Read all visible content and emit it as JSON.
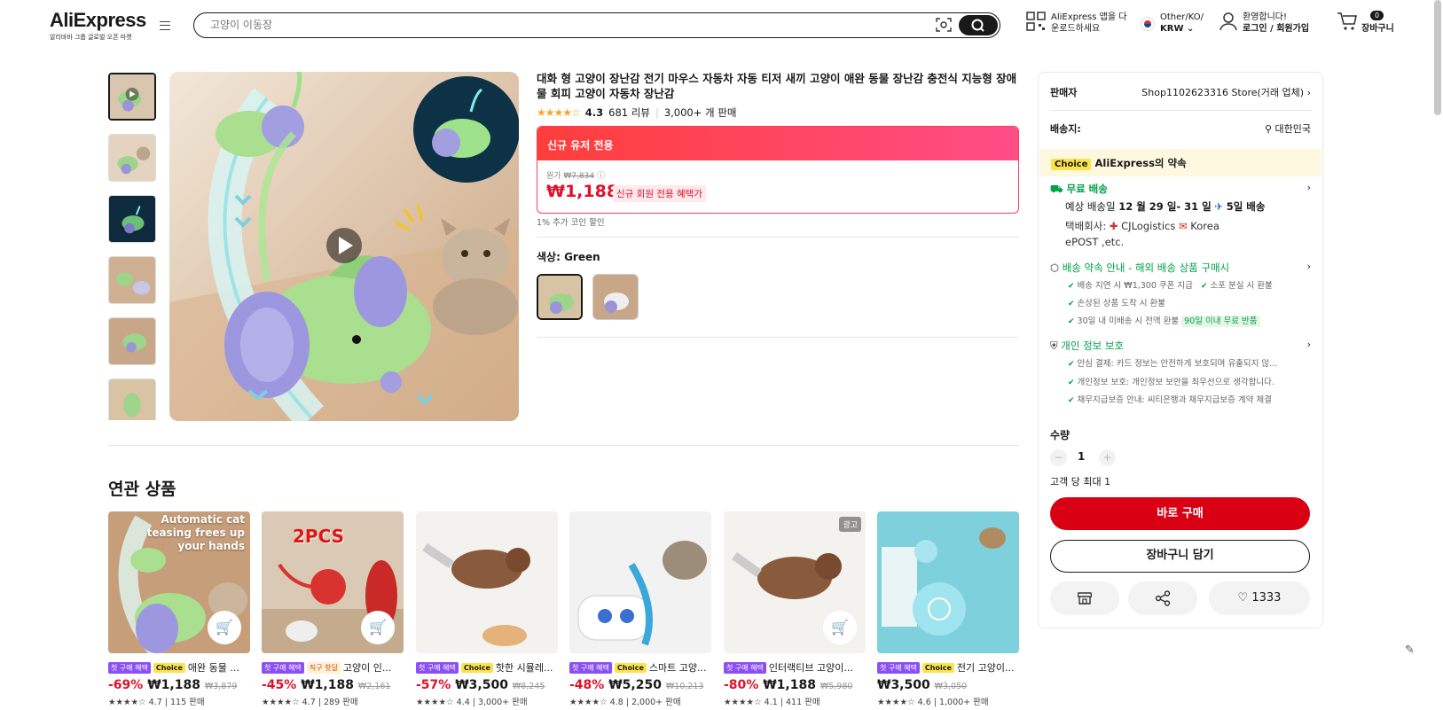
{
  "header": {
    "brand": "AliExpress",
    "brand_sub": "알리바바 그룹 글로벌 오픈 마켓",
    "search_placeholder": "고양이 이동장",
    "app_line1": "AliExpress 앱을 다",
    "app_line2": "운로드하세요",
    "region_line1": "Other/KO/",
    "region_line2": "KRW",
    "account_line1": "환영합니다!",
    "account_line2": "로그인 / 회원가입",
    "cart_count": "0",
    "cart_label": "장바구니"
  },
  "product": {
    "title": "대화 형 고양이 장난감 전기 마우스 자동차 자동 티저 새끼 고양이 애완 동물 장난감 충전식 지능형 장애물 회피 고양이 자동차 장난감",
    "rating": "4.3",
    "reviews": "681 리뷰",
    "sold": "3,000+ 개 판매",
    "promo_header": "신규 유저 전용",
    "orig_label": "원가",
    "orig_price": "₩7,834",
    "price": "₩1,188",
    "new_member_badge": "신규 회원 전용 혜택가",
    "coin_note": "1% 추가 코인 할인",
    "color_label": "색상:",
    "color_value": "Green"
  },
  "seller": {
    "seller_label": "판매자",
    "store": "Shop1102623316 Store(거래 업체)",
    "ship_to_label": "배송지:",
    "ship_to": "대한민국",
    "choice_tag": "Choice",
    "choice_promise": "AliExpress의 약속",
    "free_shipping": "무료 배송",
    "delivery_prefix": "예상 배송일",
    "delivery_dates": "12 월 29 일- 31 일",
    "delivery_days": "5일 배송",
    "carrier_label": "택배회사:",
    "carrier1": "CJLogistics",
    "carrier2": "Korea",
    "carrier_rest": "ePOST ,etc.",
    "guarantee_title": "배송 약속 안내 - 해외 배송 상품 구매시",
    "g1": "배송 지연 시 ₩1,300 쿠폰 지급",
    "g2": "소포 분실 시 환불",
    "g3": "손상된 상품 도착 시 환불",
    "g4": "30일 내 미배송 시 전액 환불",
    "g4_tag": "90일 이내 무료 반품",
    "privacy_title": "개인 정보 보호",
    "p1": "안심 결제: 카드 정보는 안전하게 보호되며 유출되지 않...",
    "p2": "개인정보 보호: 개인정보 보안을 최우선으로 생각합니다.",
    "p3": "채무지급보증 안내: 씨티은행과 채무지급보증 계약 체결",
    "qty_label": "수량",
    "qty_value": "1",
    "qty_limit": "고객 당 최대 1",
    "buy_now": "바로 구매",
    "add_to_cart": "장바구니 담기",
    "wish_count": "1333"
  },
  "related": {
    "title": "연관 상품",
    "items": [
      {
        "tag1": "첫 구매 혜택",
        "tag2": "Choice",
        "name": "애완 동물 ...",
        "disc": "-69%",
        "price": "₩1,188",
        "orig": "₩3,879",
        "rating": "4.7",
        "sold": "115 판매"
      },
      {
        "tag1": "첫 구매 혜택",
        "tag2": "직구 핫딜",
        "name": "고양이 인...",
        "disc": "-45%",
        "price": "₩1,188",
        "orig": "₩2,161",
        "rating": "4.7",
        "sold": "289 판매"
      },
      {
        "tag1": "첫 구매 혜택",
        "tag2": "Choice",
        "name": "핫한 시뮬레...",
        "disc": "-57%",
        "price": "₩3,500",
        "orig": "₩8,245",
        "rating": "4.4",
        "sold": "3,000+ 판매"
      },
      {
        "tag1": "첫 구매 혜택",
        "tag2": "Choice",
        "name": "스마트 고양...",
        "disc": "-48%",
        "price": "₩5,250",
        "orig": "₩10,213",
        "rating": "4.8",
        "sold": "2,000+ 판매"
      },
      {
        "tag1": "첫 구매 혜택",
        "tag2": "",
        "name": "인터랙티브 고양이...",
        "disc": "-80%",
        "price": "₩1,188",
        "orig": "₩5,980",
        "rating": "4.1",
        "sold": "411 판매",
        "ad": "광고"
      },
      {
        "tag1": "첫 구매 혜택",
        "tag2": "Choice",
        "name": "전기 고양이...",
        "disc": "",
        "price": "₩3,500",
        "orig": "₩3,050",
        "rating": "4.6",
        "sold": "1,000+ 판매"
      }
    ],
    "card1_overlay_1": "Automatic cat",
    "card1_overlay_2": "teasing frees up",
    "card1_overlay_3": "your hands",
    "card2_overlay": "2PCS"
  }
}
